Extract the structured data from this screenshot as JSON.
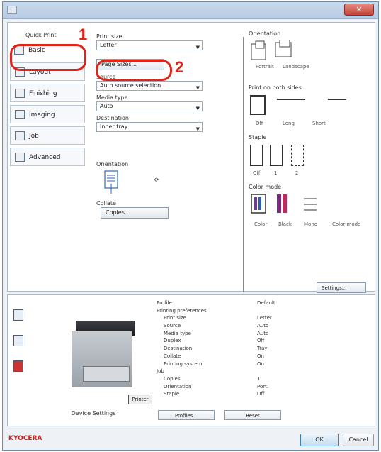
{
  "window": {
    "close_glyph": "✕"
  },
  "sidebar": {
    "header": "Quick Print",
    "items": [
      {
        "label": "Basic",
        "icon": "basic-icon"
      },
      {
        "label": "Layout",
        "icon": "layout-icon"
      },
      {
        "label": "Finishing",
        "icon": "finishing-icon"
      },
      {
        "label": "Imaging",
        "icon": "imaging-icon"
      },
      {
        "label": "Job",
        "icon": "job-icon"
      },
      {
        "label": "Advanced",
        "icon": "advanced-icon"
      }
    ]
  },
  "callouts": {
    "one": "1",
    "two": "2"
  },
  "basic": {
    "print_size_label": "Print size",
    "print_size_value": "Letter",
    "page_sizes_button": "Page Sizes...",
    "source_label": "Source",
    "source_value": "Auto source selection",
    "media_label": "Media type",
    "media_value": "Auto",
    "destination_label": "Destination",
    "destination_value": "Inner tray",
    "orientation_label": "Orientation",
    "collate_label": "Collate",
    "copies_button": "Copies..."
  },
  "right": {
    "orientation_label": "Orientation",
    "orientation_opts": [
      "Portrait",
      "Landscape"
    ],
    "duplex_label": "Print on both sides",
    "duplex_opts": [
      "Off",
      "Long",
      "Short"
    ],
    "staple_label": "Staple",
    "staple_opts": [
      "Off",
      "1",
      "2"
    ],
    "color_label": "Color mode",
    "color_opts": [
      "Color",
      "Black",
      "Mono"
    ],
    "mode_extra": "Color mode",
    "settings_button": "Settings..."
  },
  "preview": {
    "tag": "Printer",
    "caption": "Device Settings"
  },
  "summary": {
    "rows": [
      {
        "k": "Profile",
        "v": "Default"
      },
      {
        "k": "Printing preferences",
        "v": ""
      },
      {
        "k": "Print size",
        "v": "Letter"
      },
      {
        "k": "Source",
        "v": "Auto"
      },
      {
        "k": "Media type",
        "v": "Auto"
      },
      {
        "k": "Duplex",
        "v": "Off"
      },
      {
        "k": "Destination",
        "v": "Tray"
      },
      {
        "k": "Collate",
        "v": "On"
      },
      {
        "k": "Printing system",
        "v": "On"
      },
      {
        "k": "Job",
        "v": ""
      },
      {
        "k": "Copies",
        "v": "1"
      },
      {
        "k": "Orientation",
        "v": "Port."
      },
      {
        "k": "Staple",
        "v": "Off"
      }
    ],
    "btn_profiles": "Profiles...",
    "btn_reset": "Reset"
  },
  "footer": {
    "logo": "KYOCERA",
    "ok": "OK",
    "cancel": "Cancel"
  }
}
